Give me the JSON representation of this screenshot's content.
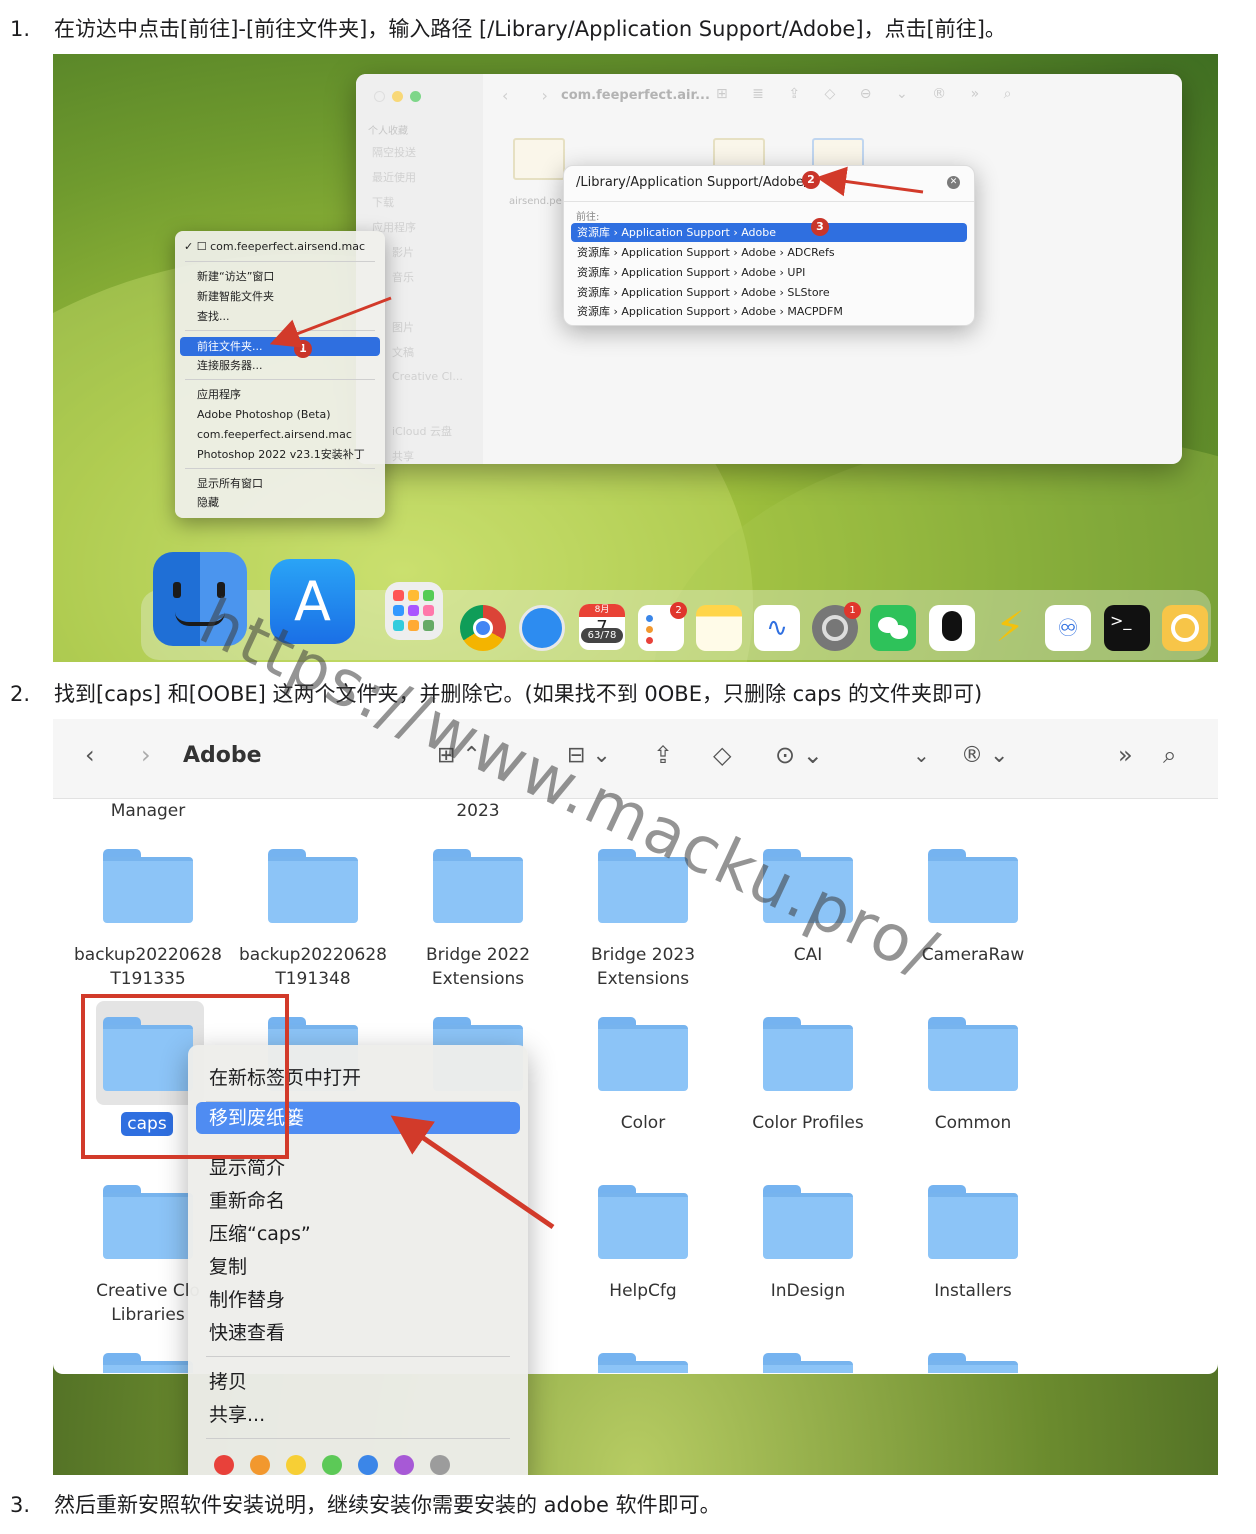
{
  "steps": [
    {
      "num": "1.",
      "text": "在访达中点击[前往]-[前往文件夹]，输入路径 [/Library/Application Support/Adobe]，点击[前往]。"
    },
    {
      "num": "2.",
      "text": "找到[caps] 和[OOBE] 这两个文件夹，并删除它。(如果找不到 0OBE，只删除 caps 的文件夹即可)"
    },
    {
      "num": "3.",
      "text": "然后重新安照软件安装说明，继续安装你需要安装的 adobe 软件即可。"
    }
  ],
  "shot1": {
    "window_title": "com.feeperfect.air...",
    "sidebar_title": "个人收藏",
    "sidebar_items": [
      "隔空投送",
      "最近使用",
      "下载",
      "应用程序",
      "影片",
      "音乐",
      "图片",
      "文稿",
      "Creative Cl...",
      "iCloud 云盘",
      "共享"
    ],
    "file_name": "airsend.pe",
    "goto_path": "/Library/Application Support/Adobe/",
    "goto_label": "前往:",
    "goto_results": [
      "资源库 › Application Support › Adobe",
      "资源库 › Application Support › Adobe › ADCRefs",
      "资源库 › Application Support › Adobe › UPI",
      "资源库 › Application Support › Adobe › SLStore",
      "资源库 › Application Support › Adobe › MACPDFM"
    ],
    "menu_items": [
      "✓ ☐ com.feeperfect.airsend.mac",
      "新建“访达”窗口",
      "新建智能文件夹",
      "查找...",
      "前往文件夹...",
      "连接服务器...",
      "应用程序",
      "Adobe Photoshop (Beta)",
      "com.feeperfect.airsend.mac",
      "Photoshop 2022 v23.1安装补丁",
      "显示所有窗口",
      "隐藏"
    ],
    "markers": [
      "1",
      "2",
      "3"
    ],
    "calendar": {
      "month": "8月",
      "day": "7",
      "badge": "63/78"
    },
    "dock_badges": [
      "2",
      "1"
    ]
  },
  "shot2": {
    "window_title": "Adobe",
    "top_row_labels": [
      "Manager",
      "2023"
    ],
    "folders_row1": [
      "backup20220628\nT191335",
      "backup20220628\nT191348",
      "Bridge 2022\nExtensions",
      "Bridge 2023\nExtensions",
      "CAI",
      "CameraRaw"
    ],
    "selected_folder": "caps",
    "folders_row2": [
      "Color",
      "Color Profiles",
      "Common"
    ],
    "folders_row3": [
      "Creative Clo\nLibraries",
      "HelpCfg",
      "InDesign",
      "Installers"
    ],
    "context_menu": [
      "在新标签页中打开",
      "移到废纸篓",
      "显示简介",
      "重新命名",
      "压缩“caps”",
      "复制",
      "制作替身",
      "快速查看",
      "拷贝",
      "共享..."
    ],
    "tag_colors": [
      "#e8413a",
      "#f2982e",
      "#f7cf35",
      "#5cc957",
      "#3b86e8",
      "#a759d6",
      "#9c9c9c"
    ]
  },
  "watermark": "https://www.macku.pro/"
}
